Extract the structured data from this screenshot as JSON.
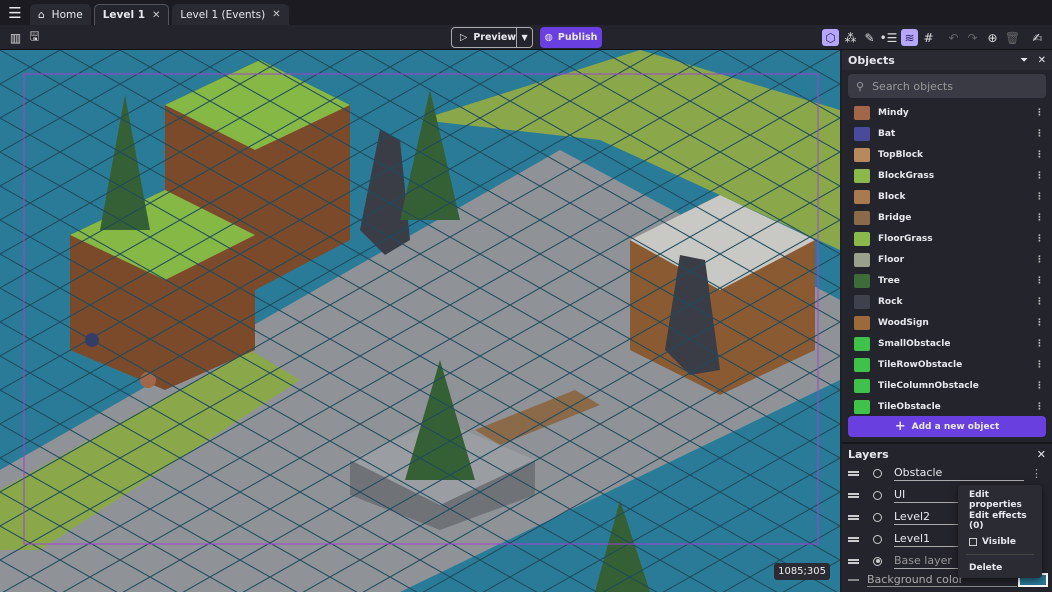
{
  "tabs": {
    "home": "Home",
    "level1": "Level 1",
    "events": "Level 1 (Events)"
  },
  "toolbar": {
    "preview": "Preview",
    "publish": "Publish"
  },
  "canvas": {
    "coords": "1085;305"
  },
  "objects": {
    "title": "Objects",
    "search_placeholder": "Search objects",
    "add": "Add a new object",
    "items": [
      {
        "name": "Mindy",
        "color": "#a0674a"
      },
      {
        "name": "Bat",
        "color": "#4a4a9a"
      },
      {
        "name": "TopBlock",
        "color": "#b9895e"
      },
      {
        "name": "BlockGrass",
        "color": "#8ab84a"
      },
      {
        "name": "Block",
        "color": "#a97a50"
      },
      {
        "name": "Bridge",
        "color": "#8a6a48"
      },
      {
        "name": "FloorGrass",
        "color": "#8ab84a"
      },
      {
        "name": "Floor",
        "color": "#9aa08e"
      },
      {
        "name": "Tree",
        "color": "#3e6b3a"
      },
      {
        "name": "Rock",
        "color": "#3f424c"
      },
      {
        "name": "WoodSign",
        "color": "#9a6a3a"
      },
      {
        "name": "SmallObstacle",
        "color": "#3ec24a"
      },
      {
        "name": "TileRowObstacle",
        "color": "#3ec24a"
      },
      {
        "name": "TileColumnObstacle",
        "color": "#3ec24a"
      },
      {
        "name": "TileObstacle",
        "color": "#3ec24a"
      }
    ]
  },
  "layers": {
    "title": "Layers",
    "items": [
      "Obstacle",
      "UI",
      "Level2",
      "Level1",
      "Base layer"
    ],
    "background": "Background color",
    "bg_color": "#2a7b98"
  },
  "context_menu": {
    "edit_properties": "Edit properties",
    "edit_effects": "Edit effects (0)",
    "visible": "Visible",
    "delete": "Delete"
  }
}
